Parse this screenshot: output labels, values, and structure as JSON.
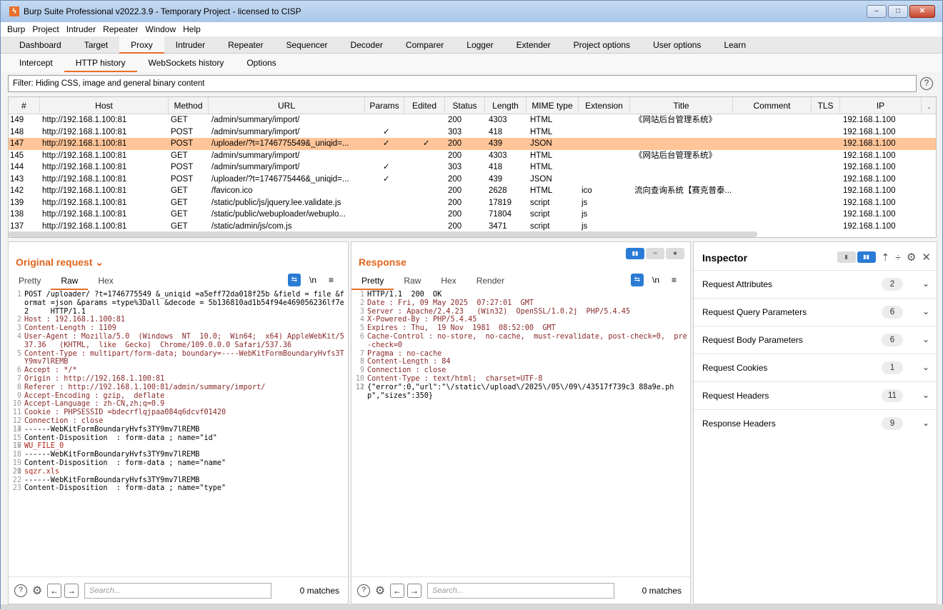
{
  "window": {
    "title": "Burp Suite Professional v2022.3.9 - Temporary Project - licensed to CISP",
    "btn_min": "‒",
    "btn_max": "□",
    "btn_close": "✕"
  },
  "menu": [
    "Burp",
    "Project",
    "Intruder",
    "Repeater",
    "Window",
    "Help"
  ],
  "main_tabs": [
    "Dashboard",
    "Target",
    "Proxy",
    "Intruder",
    "Repeater",
    "Sequencer",
    "Decoder",
    "Comparer",
    "Logger",
    "Extender",
    "Project options",
    "User options",
    "Learn"
  ],
  "proxy_tabs": [
    "Intercept",
    "HTTP history",
    "WebSockets history",
    "Options"
  ],
  "filter": "Filter: Hiding CSS, image and general binary content",
  "table": {
    "columns": [
      "#",
      "Host",
      "Method",
      "URL",
      "Params",
      "Edited",
      "Status",
      "Length",
      "MIME type",
      "Extension",
      "Title",
      "Comment",
      "TLS",
      "IP",
      "."
    ],
    "rows": [
      {
        "num": "149",
        "host": "http://192.168.1.100:81",
        "method": "GET",
        "url": "/admin/summary/import/",
        "params": "",
        "edited": "",
        "status": "200",
        "length": "4303",
        "mime": "HTML",
        "ext": "",
        "title": "《网站后台管理系统》",
        "ip": "192.168.1.100"
      },
      {
        "num": "148",
        "host": "http://192.168.1.100:81",
        "method": "POST",
        "url": "/admin/summary/import/",
        "params": "✓",
        "edited": "",
        "status": "303",
        "length": "418",
        "mime": "HTML",
        "ext": "",
        "title": "",
        "ip": "192.168.1.100"
      },
      {
        "num": "147",
        "host": "http://192.168.1.100:81",
        "method": "POST",
        "url": "/uploader/?t=1746775549&_uniqid=...",
        "params": "✓",
        "edited": "✓",
        "status": "200",
        "length": "439",
        "mime": "JSON",
        "ext": "",
        "title": "",
        "ip": "192.168.1.100",
        "selected": true
      },
      {
        "num": "145",
        "host": "http://192.168.1.100:81",
        "method": "GET",
        "url": "/admin/summary/import/",
        "params": "",
        "edited": "",
        "status": "200",
        "length": "4303",
        "mime": "HTML",
        "ext": "",
        "title": "《网站后台管理系统》",
        "ip": "192.168.1.100"
      },
      {
        "num": "144",
        "host": "http://192.168.1.100:81",
        "method": "POST",
        "url": "/admin/summary/import/",
        "params": "✓",
        "edited": "",
        "status": "303",
        "length": "418",
        "mime": "HTML",
        "ext": "",
        "title": "",
        "ip": "192.168.1.100"
      },
      {
        "num": "143",
        "host": "http://192.168.1.100:81",
        "method": "POST",
        "url": "/uploader/?t=1746775446&_uniqid=...",
        "params": "✓",
        "edited": "",
        "status": "200",
        "length": "439",
        "mime": "JSON",
        "ext": "",
        "title": "",
        "ip": "192.168.1.100"
      },
      {
        "num": "142",
        "host": "http://192.168.1.100:81",
        "method": "GET",
        "url": "/favicon.ico",
        "params": "",
        "edited": "",
        "status": "200",
        "length": "2628",
        "mime": "HTML",
        "ext": "ico",
        "title": "流向查询系统【赛克普泰...",
        "ip": "192.168.1.100"
      },
      {
        "num": "139",
        "host": "http://192.168.1.100:81",
        "method": "GET",
        "url": "/static/public/js/jquery.lee.validate.js",
        "params": "",
        "edited": "",
        "status": "200",
        "length": "17819",
        "mime": "script",
        "ext": "js",
        "title": "",
        "ip": "192.168.1.100"
      },
      {
        "num": "138",
        "host": "http://192.168.1.100:81",
        "method": "GET",
        "url": "/static/public/webuploader/webuplo...",
        "params": "",
        "edited": "",
        "status": "200",
        "length": "71804",
        "mime": "script",
        "ext": "js",
        "title": "",
        "ip": "192.168.1.100"
      },
      {
        "num": "137",
        "host": "http://192.168.1.100:81",
        "method": "GET",
        "url": "/static/admin/js/com.js",
        "params": "",
        "edited": "",
        "status": "200",
        "length": "3471",
        "mime": "script",
        "ext": "js",
        "title": "",
        "ip": "192.168.1.100"
      }
    ]
  },
  "request": {
    "title": "Original request ⌄",
    "tabs": [
      "Pretty",
      "Raw",
      "Hex"
    ],
    "newline_label": "\\n",
    "menu_label": "≡",
    "lines": [
      [
        "1",
        "POST /uploader/ ?t=1746775549 &_uniqid =a5eff72da018f25b &field = file &format =json &params =type%3Dall &decode = 5b136810ad1b54f94e469056236lf7e2     HTTP/1.1"
      ],
      [
        "2",
        "Host : 192.168.1.100:81"
      ],
      [
        "3",
        "Content-Length : 1109"
      ],
      [
        "4",
        "User-Agent : Mozilla/5.0  (Windows  NT  10.0;  Win64;  x64) AppleWebKit/537.36   (KHTML,  like  Gecko)  Chrome/109.0.0.0 Safari/537.36"
      ],
      [
        "5",
        "Content-Type : multipart/form-data; boundary=----WebKitFormBoundaryHvfs3TY9mv7lREMB"
      ],
      [
        "6",
        "Accept : */*"
      ],
      [
        "7",
        "Origin : http://192.168.1.100:81"
      ],
      [
        "8",
        "Referer : http://192.168.1.100:81/admin/summary/import/"
      ],
      [
        "9",
        "Accept-Encoding : gzip,  deflate"
      ],
      [
        "10",
        "Accept-Language : zh-CN,zh;q=0.9"
      ],
      [
        "11",
        "Cookie : PHPSESSID =bdecrflqjpaa084q6dcvf01420"
      ],
      [
        "12",
        "Connection : close"
      ],
      [
        "13",
        ""
      ],
      [
        "14",
        "------WebKitFormBoundaryHvfs3TY9mv7lREMB"
      ],
      [
        "15",
        "Content-Disposition  : form-data ; name=\"id\""
      ],
      [
        "16",
        ""
      ],
      [
        "17",
        "WU_FILE_0"
      ],
      [
        "18",
        "------WebKitFormBoundaryHvfs3TY9mv7lREMB"
      ],
      [
        "19",
        "Content-Disposition  : form-data ; name=\"name\""
      ],
      [
        "20",
        ""
      ],
      [
        "21",
        "sqzr.xls"
      ],
      [
        "22",
        "------WebKitFormBoundaryHvfs3TY9mv7lREMB"
      ],
      [
        "23",
        "Content-Disposition  : form-data ; name=\"type\""
      ]
    ],
    "search_placeholder": "Search...",
    "matches": "0 matches"
  },
  "response": {
    "title": "Response",
    "tabs": [
      "Pretty",
      "Raw",
      "Hex",
      "Render"
    ],
    "newline_label": "\\n",
    "menu_label": "≡",
    "lines": [
      [
        "1",
        "HTTP/1.1  200  OK"
      ],
      [
        "2",
        "Date : Fri, 09 May 2025  07:27:01  GMT"
      ],
      [
        "3",
        "Server : Apache/2.4.23   (Win32)  OpenSSL/1.0.2j  PHP/5.4.45"
      ],
      [
        "4",
        "X-Powered-By : PHP/5.4.45"
      ],
      [
        "5",
        "Expires : Thu,  19 Nov  1981  08:52:00  GMT"
      ],
      [
        "6",
        "Cache-Control : no-store,  no-cache,  must-revalidate, post-check=0,  pre-check=0"
      ],
      [
        "7",
        "Pragma : no-cache"
      ],
      [
        "8",
        "Content-Length : 84"
      ],
      [
        "9",
        "Connection : close"
      ],
      [
        "10",
        "Content-Type : text/html;  charset=UTF-8"
      ],
      [
        "11",
        ""
      ],
      [
        "12",
        "{\"error\":0,\"url\":\"\\/static\\/upload\\/2025\\/05\\/09\\/43517f739c3 88a9e.php\",\"sizes\":350}"
      ]
    ],
    "search_placeholder": "Search...",
    "matches": "0 matches"
  },
  "inspector": {
    "title": "Inspector",
    "sections": [
      {
        "label": "Request Attributes",
        "count": "2"
      },
      {
        "label": "Request Query Parameters",
        "count": "6"
      },
      {
        "label": "Request Body Parameters",
        "count": "6"
      },
      {
        "label": "Request Cookies",
        "count": "1"
      },
      {
        "label": "Request Headers",
        "count": "11"
      },
      {
        "label": "Response Headers",
        "count": "9"
      }
    ]
  }
}
